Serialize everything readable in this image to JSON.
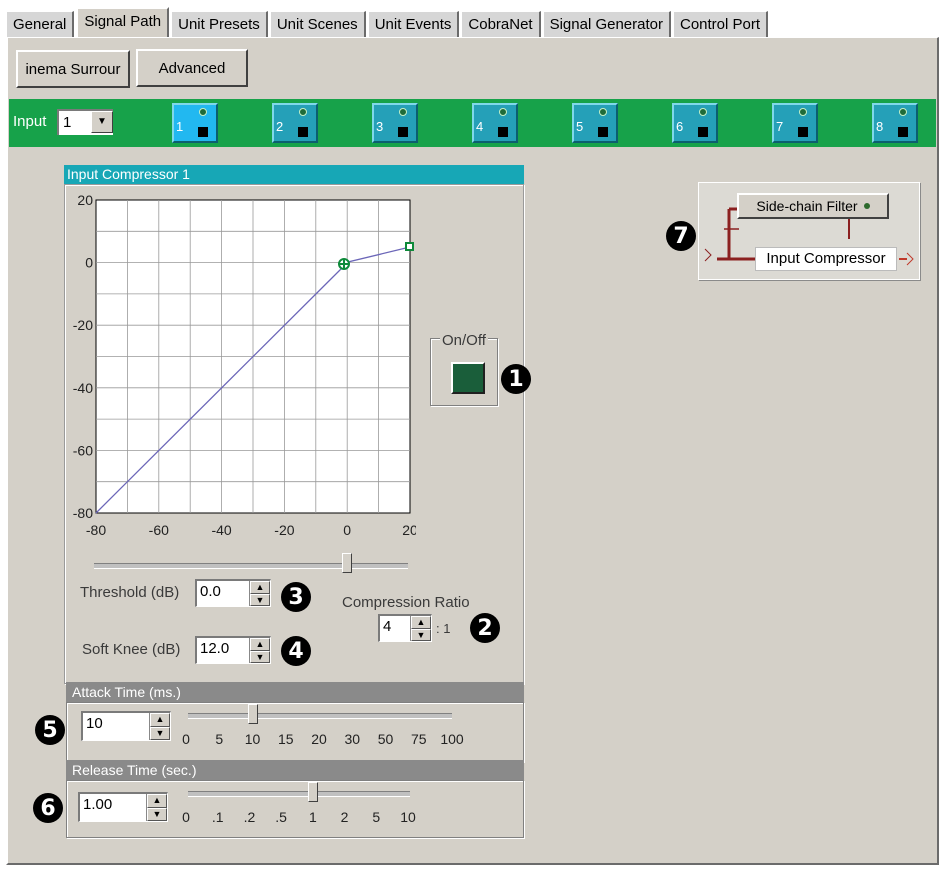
{
  "tabs": [
    {
      "label": "General"
    },
    {
      "label": "Signal Path"
    },
    {
      "label": "Unit Presets"
    },
    {
      "label": "Unit Scenes"
    },
    {
      "label": "Unit Events"
    },
    {
      "label": "CobraNet"
    },
    {
      "label": "Signal Generator"
    },
    {
      "label": "Control Port"
    }
  ],
  "toolbar": {
    "surround_label": "inema Surrour",
    "advanced_label": "Advanced"
  },
  "input_selector": {
    "label": "Input",
    "value": "1"
  },
  "channels": [
    "1",
    "2",
    "3",
    "4",
    "5",
    "6",
    "7",
    "8"
  ],
  "compressor": {
    "title": "Input Compressor 1",
    "on_off_label": "On/Off",
    "threshold_label": "Threshold (dB)",
    "threshold_value": "0.0",
    "soft_knee_label": "Soft Knee (dB)",
    "soft_knee_value": "12.0",
    "ratio_label": "Compression Ratio",
    "ratio_value": "4",
    "ratio_suffix": ": 1"
  },
  "graph": {
    "y_ticks": [
      "20",
      "0",
      "-20",
      "-40",
      "-60",
      "-80"
    ],
    "x_ticks": [
      "-80",
      "-60",
      "-40",
      "-20",
      "0",
      "20"
    ]
  },
  "attack": {
    "title": "Attack Time (ms.)",
    "value": "10",
    "scale": [
      "0",
      "5",
      "10",
      "15",
      "20",
      "30",
      "50",
      "75",
      "100"
    ],
    "position": 0.25
  },
  "release": {
    "title": "Release Time (sec.)",
    "value": "1.00",
    "scale": [
      "0",
      ".1",
      ".2",
      ".5",
      "1",
      "2",
      "5",
      "10"
    ],
    "position": 0.57
  },
  "sidechain": {
    "filter_label": "Side-chain Filter",
    "compressor_label": "Input Compressor"
  },
  "callouts": [
    "1",
    "2",
    "3",
    "4",
    "5",
    "6",
    "7"
  ],
  "colors": {
    "green_bar": "#17a24a",
    "teal": "#17a7b6",
    "on_button": "#1a5e3a"
  }
}
